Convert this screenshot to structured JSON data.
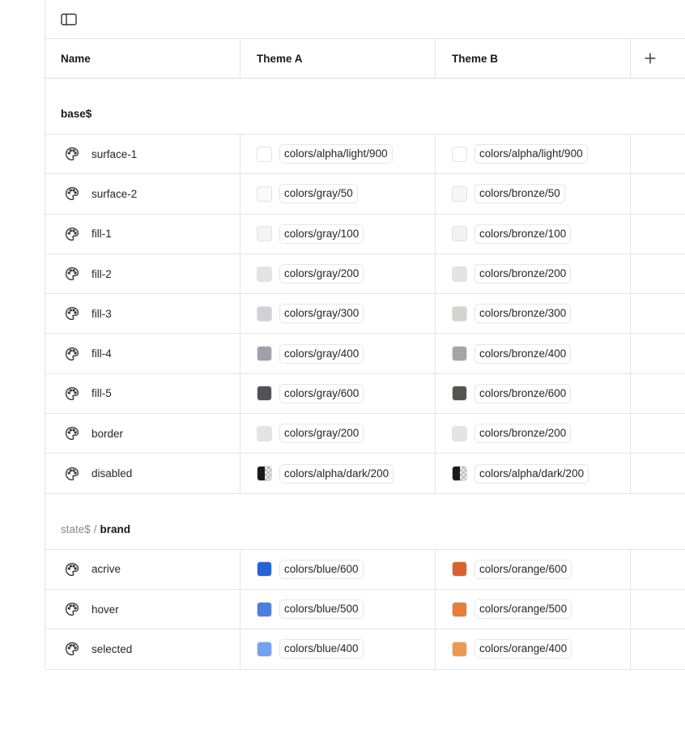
{
  "toolbar": {
    "sidebar_toggle_icon": "sidebar-panel-icon"
  },
  "table": {
    "headers": {
      "name": "Name",
      "theme_a": "Theme A",
      "theme_b": "Theme B",
      "add": "+"
    }
  },
  "groups": [
    {
      "prefix": "",
      "title": "base$",
      "rows": [
        {
          "name": "surface-1",
          "a": {
            "label": "colors/alpha/light/900",
            "color": "#ffffff"
          },
          "b": {
            "label": "colors/alpha/light/900",
            "color": "#ffffff"
          }
        },
        {
          "name": "surface-2",
          "a": {
            "label": "colors/gray/50",
            "color": "#fafafa"
          },
          "b": {
            "label": "colors/bronze/50",
            "color": "#f8f7f7"
          }
        },
        {
          "name": "fill-1",
          "a": {
            "label": "colors/gray/100",
            "color": "#f4f4f5"
          },
          "b": {
            "label": "colors/bronze/100",
            "color": "#f3f2f2"
          }
        },
        {
          "name": "fill-2",
          "a": {
            "label": "colors/gray/200",
            "color": "#e4e4e7"
          },
          "b": {
            "label": "colors/bronze/200",
            "color": "#e5e3e3"
          }
        },
        {
          "name": "fill-3",
          "a": {
            "label": "colors/gray/300",
            "color": "#d1d1d6"
          },
          "b": {
            "label": "colors/bronze/300",
            "color": "#d6d2d1"
          }
        },
        {
          "name": "fill-4",
          "a": {
            "label": "colors/gray/400",
            "color": "#a1a1aa"
          },
          "b": {
            "label": "colors/bronze/400",
            "color": "#a9a4a3"
          }
        },
        {
          "name": "fill-5",
          "a": {
            "label": "colors/gray/600",
            "color": "#52525b"
          },
          "b": {
            "label": "colors/bronze/600",
            "color": "#575352"
          }
        },
        {
          "name": "border",
          "a": {
            "label": "colors/gray/200",
            "color": "#e4e4e7"
          },
          "b": {
            "label": "colors/bronze/200",
            "color": "#e5e3e3"
          }
        },
        {
          "name": "disabled",
          "a": {
            "label": "colors/alpha/dark/200",
            "color": "#1a1a1a",
            "pattern": "checker"
          },
          "b": {
            "label": "colors/alpha/dark/200",
            "color": "#1a1a1a",
            "pattern": "checker"
          }
        }
      ]
    },
    {
      "prefix": "state$",
      "separator": "/",
      "title": "brand",
      "rows": [
        {
          "name": "acrive",
          "a": {
            "label": "colors/blue/600",
            "color": "#2563db"
          },
          "b": {
            "label": "colors/orange/600",
            "color": "#d8632e"
          }
        },
        {
          "name": "hover",
          "a": {
            "label": "colors/blue/500",
            "color": "#4a7fe0"
          },
          "b": {
            "label": "colors/orange/500",
            "color": "#e97c37"
          }
        },
        {
          "name": "selected",
          "a": {
            "label": "colors/blue/400",
            "color": "#71a3ee"
          },
          "b": {
            "label": "colors/orange/400",
            "color": "#ef984f"
          }
        }
      ]
    }
  ]
}
